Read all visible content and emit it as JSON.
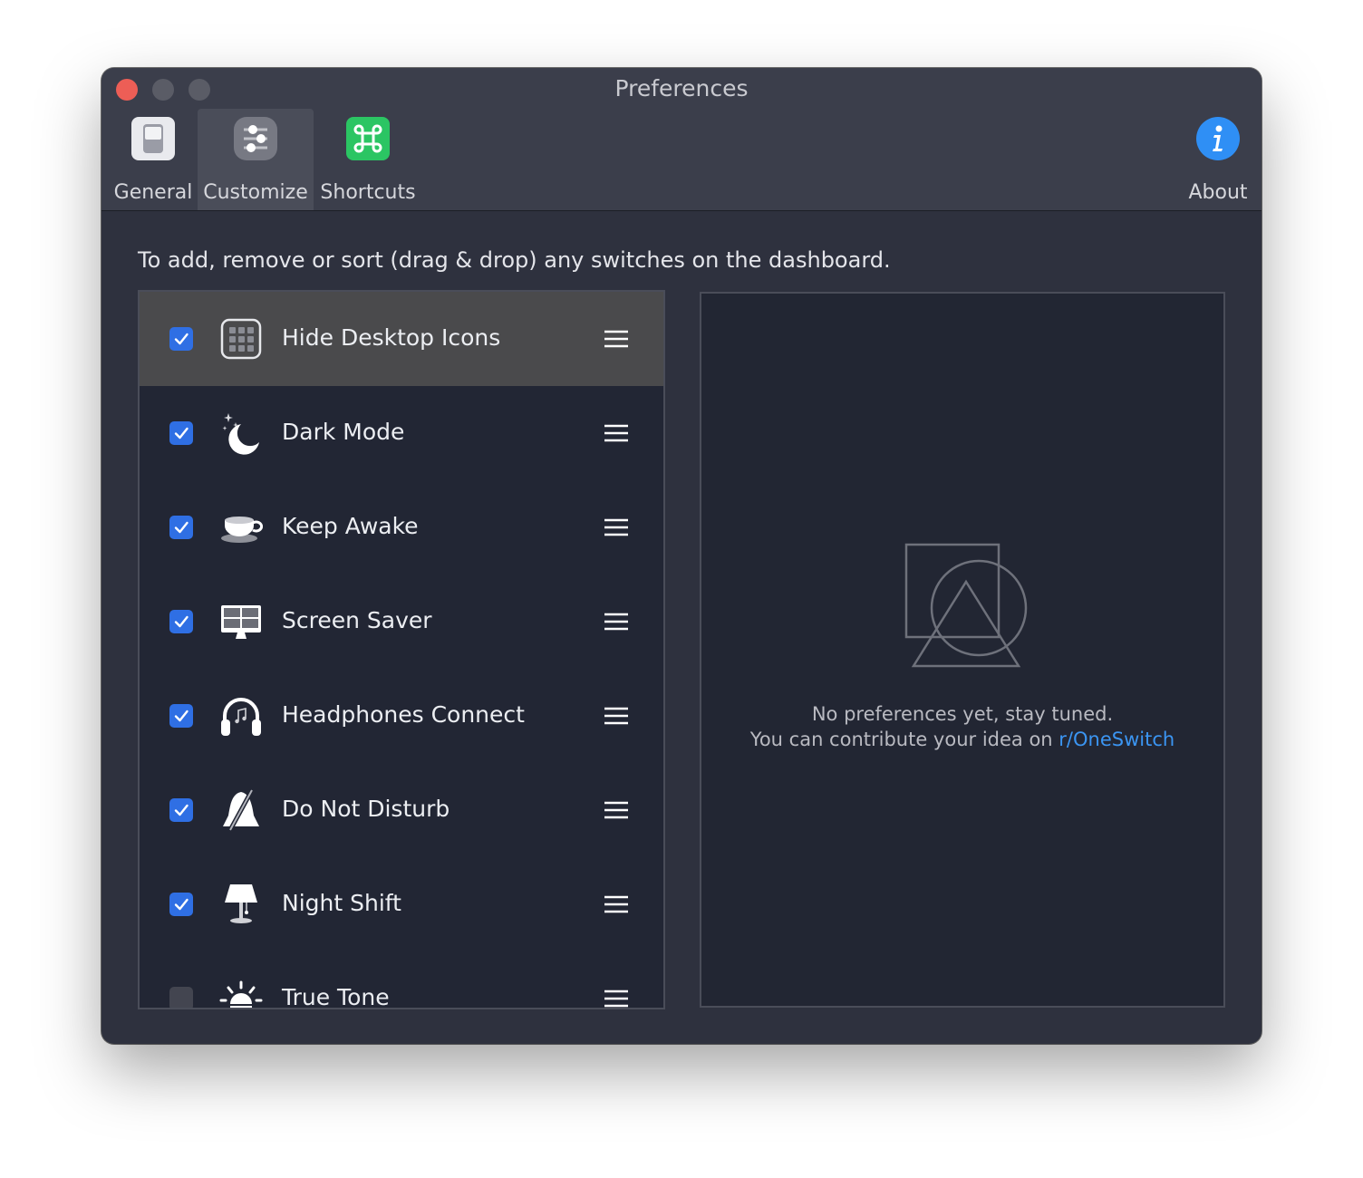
{
  "window": {
    "title": "Preferences"
  },
  "tabs": {
    "general": "General",
    "customize": "Customize",
    "shortcuts": "Shortcuts",
    "about": "About",
    "selected": "customize"
  },
  "instructions": "To add, remove or sort (drag & drop) any switches on the dashboard.",
  "switches": [
    {
      "label": "Hide Desktop Icons",
      "checked": true,
      "icon": "desktop-grid-icon",
      "selected": true
    },
    {
      "label": "Dark Mode",
      "checked": true,
      "icon": "moon-icon"
    },
    {
      "label": "Keep Awake",
      "checked": true,
      "icon": "coffee-cup-icon"
    },
    {
      "label": "Screen Saver",
      "checked": true,
      "icon": "monitor-icon"
    },
    {
      "label": "Headphones Connect",
      "checked": true,
      "icon": "headphones-icon"
    },
    {
      "label": "Do Not Disturb",
      "checked": true,
      "icon": "bell-slash-icon"
    },
    {
      "label": "Night Shift",
      "checked": true,
      "icon": "lamp-icon"
    },
    {
      "label": "True Tone",
      "checked": false,
      "icon": "sun-icon"
    }
  ],
  "empty_state": {
    "line1": "No preferences yet, stay tuned.",
    "line2_prefix": "You can contribute your idea on",
    "link": "r/OneSwitch",
    "link_color": "#3b95f2"
  },
  "colors": {
    "accent": "#2f6fe4",
    "close": "#ed5e56",
    "shortcuts_icon": "#2bc563",
    "about_icon": "#2f8ff5"
  }
}
